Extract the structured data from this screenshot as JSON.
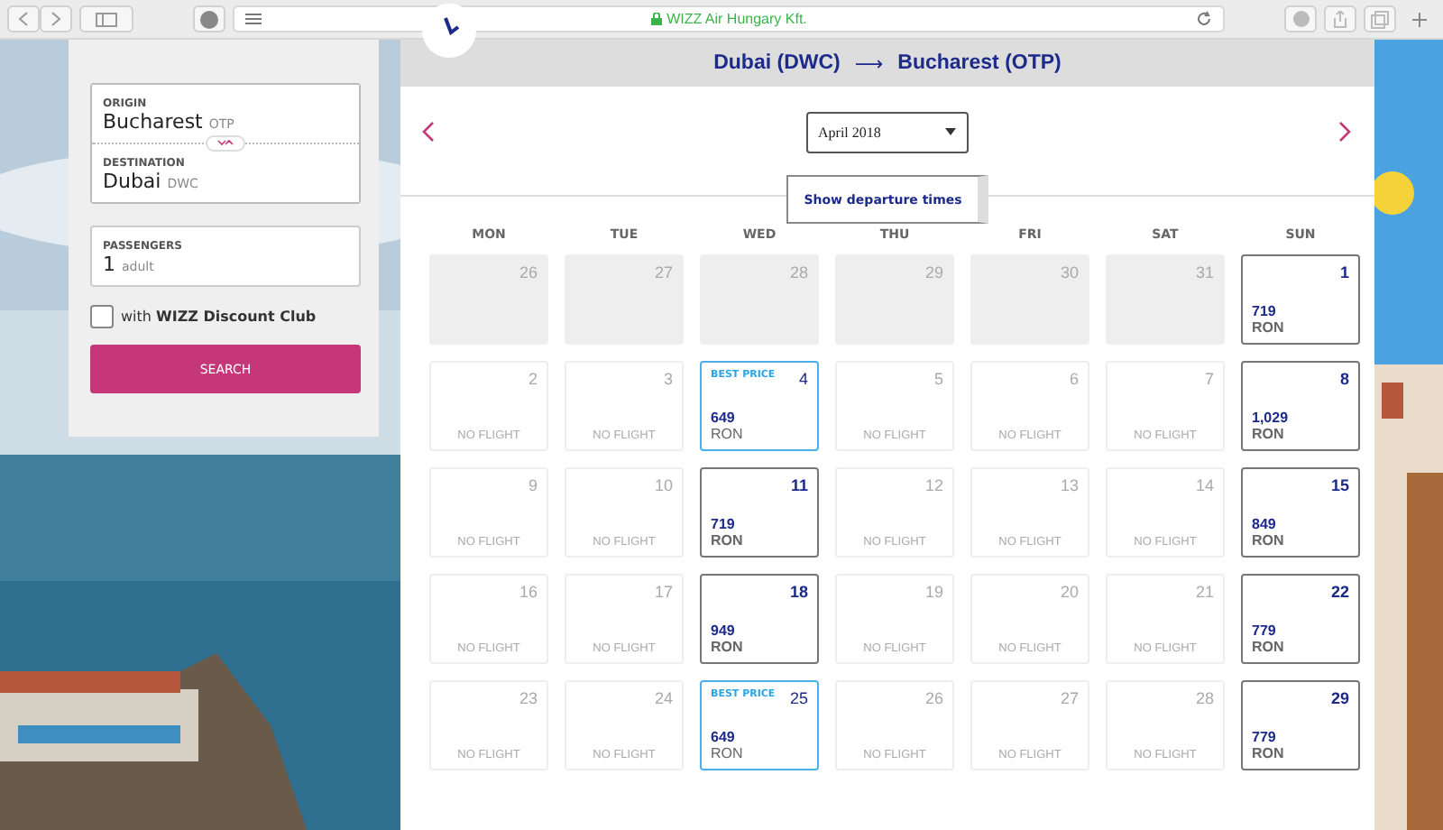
{
  "browser": {
    "url": "WIZZ Air Hungary Kft."
  },
  "search": {
    "origin_label": "ORIGIN",
    "origin_city": "Bucharest",
    "origin_code": "OTP",
    "destination_label": "DESTINATION",
    "destination_city": "Dubai",
    "destination_code": "DWC",
    "passengers_label": "PASSENGERS",
    "passengers_count": "1",
    "passengers_unit": "adult",
    "discount_text": "with **WIZZ Discount Club**",
    "discount_checked": false,
    "search_button": "SEARCH"
  },
  "calendar": {
    "route_from": "Dubai (DWC)",
    "route_arrow": "⟶",
    "route_to": "Bucharest (OTP)",
    "month": "April 2018",
    "departure_times_button": "Show departure times",
    "weekdays": [
      "MON",
      "TUE",
      "WED",
      "THU",
      "FRI",
      "SAT",
      "SUN"
    ],
    "weeks": [
      [
        {
          "kind": "other",
          "day": "26"
        },
        {
          "kind": "other",
          "day": "27"
        },
        {
          "kind": "other",
          "day": "28"
        },
        {
          "kind": "other",
          "day": "29"
        },
        {
          "kind": "other",
          "day": "30"
        },
        {
          "kind": "other",
          "day": "31"
        },
        {
          "kind": "price",
          "day": "1",
          "price": "719",
          "currency": "RON"
        }
      ],
      [
        {
          "kind": "none",
          "day": "2",
          "note": "NO FLIGHT"
        },
        {
          "kind": "none",
          "day": "3",
          "note": "NO FLIGHT"
        },
        {
          "kind": "best",
          "day": "4",
          "badge": "BEST PRICE",
          "price": "649",
          "currency": "RON"
        },
        {
          "kind": "none",
          "day": "5",
          "note": "NO FLIGHT"
        },
        {
          "kind": "none",
          "day": "6",
          "note": "NO FLIGHT"
        },
        {
          "kind": "none",
          "day": "7",
          "note": "NO FLIGHT"
        },
        {
          "kind": "price",
          "day": "8",
          "price": "1,029",
          "currency": "RON"
        }
      ],
      [
        {
          "kind": "none",
          "day": "9",
          "note": "NO FLIGHT"
        },
        {
          "kind": "none",
          "day": "10",
          "note": "NO FLIGHT"
        },
        {
          "kind": "price",
          "day": "11",
          "price": "719",
          "currency": "RON"
        },
        {
          "kind": "none",
          "day": "12",
          "note": "NO FLIGHT"
        },
        {
          "kind": "none",
          "day": "13",
          "note": "NO FLIGHT"
        },
        {
          "kind": "none",
          "day": "14",
          "note": "NO FLIGHT"
        },
        {
          "kind": "price",
          "day": "15",
          "price": "849",
          "currency": "RON"
        }
      ],
      [
        {
          "kind": "none",
          "day": "16",
          "note": "NO FLIGHT"
        },
        {
          "kind": "none",
          "day": "17",
          "note": "NO FLIGHT"
        },
        {
          "kind": "price",
          "day": "18",
          "price": "949",
          "currency": "RON"
        },
        {
          "kind": "none",
          "day": "19",
          "note": "NO FLIGHT"
        },
        {
          "kind": "none",
          "day": "20",
          "note": "NO FLIGHT"
        },
        {
          "kind": "none",
          "day": "21",
          "note": "NO FLIGHT"
        },
        {
          "kind": "price",
          "day": "22",
          "price": "779",
          "currency": "RON"
        }
      ],
      [
        {
          "kind": "none",
          "day": "23",
          "note": "NO FLIGHT"
        },
        {
          "kind": "none",
          "day": "24",
          "note": "NO FLIGHT"
        },
        {
          "kind": "best",
          "day": "25",
          "badge": "BEST PRICE",
          "price": "649",
          "currency": "RON"
        },
        {
          "kind": "none",
          "day": "26",
          "note": "NO FLIGHT"
        },
        {
          "kind": "none",
          "day": "27",
          "note": "NO FLIGHT"
        },
        {
          "kind": "none",
          "day": "28",
          "note": "NO FLIGHT"
        },
        {
          "kind": "price",
          "day": "29",
          "price": "779",
          "currency": "RON"
        }
      ]
    ]
  }
}
